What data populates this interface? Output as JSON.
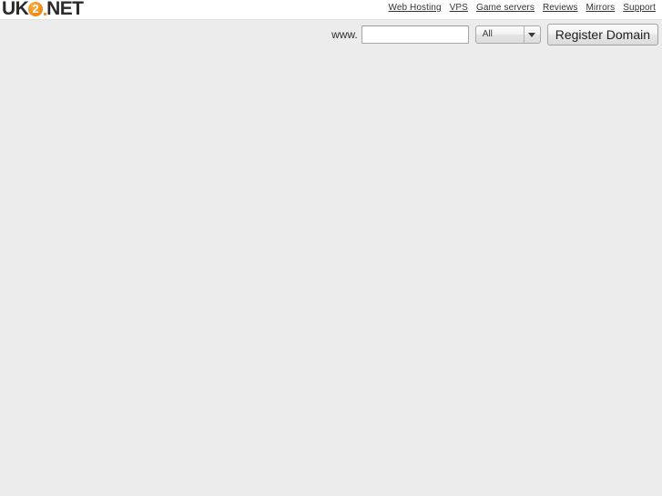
{
  "site": {
    "logo": {
      "prefix": "UK",
      "mark_digit": "2",
      "suffix": "NET",
      "full_text": "UK2.NET",
      "mark_color": "#f7941e",
      "text_color": "#2b2b2b"
    }
  },
  "topnav": {
    "items": [
      {
        "label": "Web Hosting"
      },
      {
        "label": "VPS"
      },
      {
        "label": "Game servers"
      },
      {
        "label": "Reviews"
      },
      {
        "label": "Mirrors"
      },
      {
        "label": "Support"
      }
    ]
  },
  "domain_search": {
    "prefix_label": "www.",
    "input": {
      "value": "",
      "placeholder": ""
    },
    "tld_select": {
      "selected": "All",
      "options": [
        "All"
      ],
      "arrow_icon": "chevron-down-icon"
    },
    "submit_label": "Register Domain"
  },
  "colors": {
    "page_background": "#ececed",
    "header_background": "#ffffff",
    "accent": "#f7941e",
    "link": "#333333"
  }
}
